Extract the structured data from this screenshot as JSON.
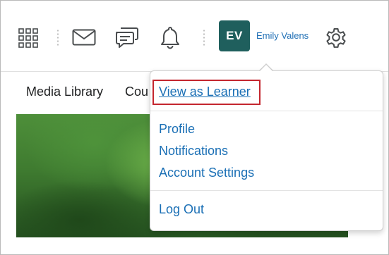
{
  "header": {
    "grid_icon": "app-grid-icon",
    "mail_icon": "envelope-icon",
    "chat_icon": "chat-bubbles-icon",
    "bell_icon": "bell-icon",
    "avatar_initials": "EV",
    "avatar_color": "#1f5f5d",
    "user_name": "Emily Valens",
    "settings_icon": "gear-icon"
  },
  "navbar": {
    "items": [
      {
        "label": "Media Library"
      },
      {
        "label": "Cou"
      }
    ]
  },
  "user_menu": {
    "view_as_learner": "View as Learner",
    "items": [
      {
        "label": "Profile"
      },
      {
        "label": "Notifications"
      },
      {
        "label": "Account Settings"
      }
    ],
    "logout": "Log Out",
    "link_color": "#1a6fb5",
    "highlight_color": "#c4262e"
  }
}
